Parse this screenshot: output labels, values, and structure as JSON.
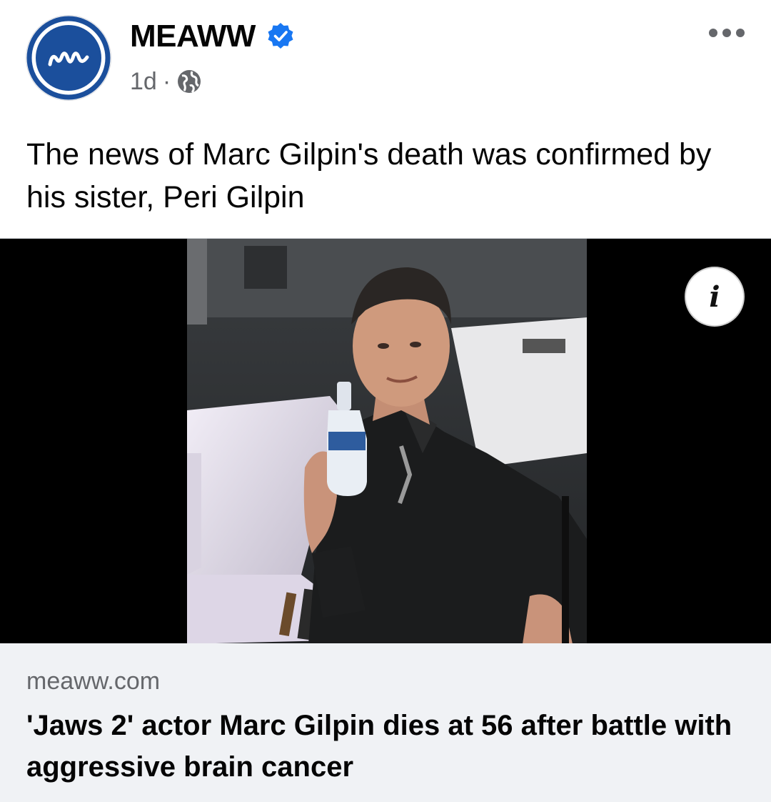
{
  "post": {
    "page_name": "MEAWW",
    "timestamp": "1d",
    "separator": "·",
    "privacy_icon": "globe-icon",
    "verified_icon": "verified-badge-icon",
    "more_icon": "more-options-icon",
    "text": "The news of Marc Gilpin's death was confirmed by his sister, Peri Gilpin"
  },
  "media": {
    "info_label": "i"
  },
  "link": {
    "domain": "meaww.com",
    "title": "'Jaws 2' actor Marc Gilpin dies at 56 after battle with aggressive brain cancer"
  },
  "colors": {
    "brand_blue": "#1b4f9c",
    "verified_blue": "#1877f2",
    "secondary_text": "#65676b",
    "card_bg": "#f0f2f5"
  }
}
